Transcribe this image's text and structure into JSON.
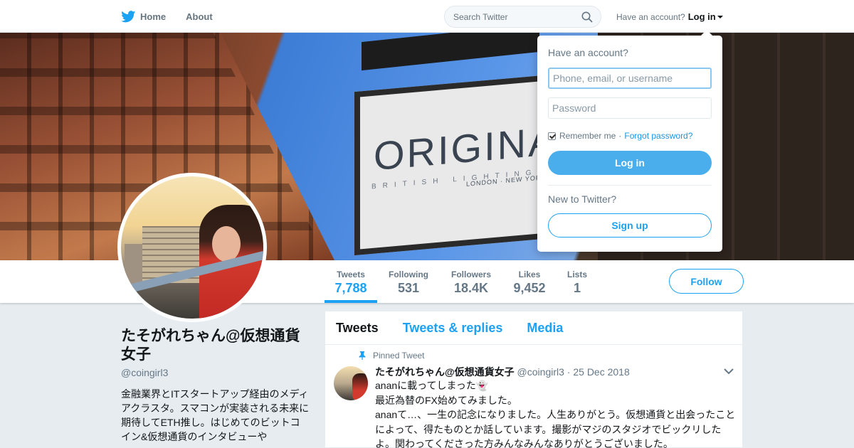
{
  "nav": {
    "home_label": "Home",
    "about_label": "About",
    "search_placeholder": "Search Twitter",
    "account_prompt": "Have an account?",
    "login_label": "Log in"
  },
  "banner": {
    "sign_text": "ORIGINA",
    "sign_subtext": "BRITISH LIGHTING M",
    "sign_cities": "LONDON · NEW YORK"
  },
  "stats": [
    {
      "label": "Tweets",
      "value": "7,788"
    },
    {
      "label": "Following",
      "value": "531"
    },
    {
      "label": "Followers",
      "value": "18.4K"
    },
    {
      "label": "Likes",
      "value": "9,452"
    },
    {
      "label": "Lists",
      "value": "1"
    }
  ],
  "follow_label": "Follow",
  "profile": {
    "name": "たそがれちゃん@仮想通貨女子",
    "handle": "@coingirl3",
    "bio": "金融業界とITスタートアップ経由のメディアクラスタ。スマコンが実装される未来に期待してETH推し。はじめてのビットコイン&仮想通貨のインタビューや"
  },
  "timeline": {
    "tabs": [
      "Tweets",
      "Tweets & replies",
      "Media"
    ],
    "pinned_label": "Pinned Tweet",
    "tweet": {
      "name": "たそがれちゃん@仮想通貨女子",
      "handle": "@coingirl3",
      "separator": "·",
      "date": "25 Dec 2018",
      "lines": [
        "ananに載ってしまった👻",
        "最近為替のFX始めてみました。",
        "ananて…、一生の記念になりました。人生ありがとう。仮想通貨と出会ったことによって、得たものとか話しています。撮影がマジのスタジオでビックリしたよ。関わってくださった方みんなみんなありがとうございました。"
      ]
    }
  },
  "login_dropdown": {
    "title": "Have an account?",
    "username_placeholder": "Phone, email, or username",
    "password_placeholder": "Password",
    "remember_label": "Remember me",
    "separator": "·",
    "forgot_label": "Forgot password?",
    "login_button": "Log in",
    "new_prompt": "New to Twitter?",
    "signup_button": "Sign up"
  },
  "colors": {
    "accent": "#1da1f2",
    "login_button": "#4aaeed",
    "muted_text": "#657786",
    "page_bg": "#e6ecf0"
  }
}
